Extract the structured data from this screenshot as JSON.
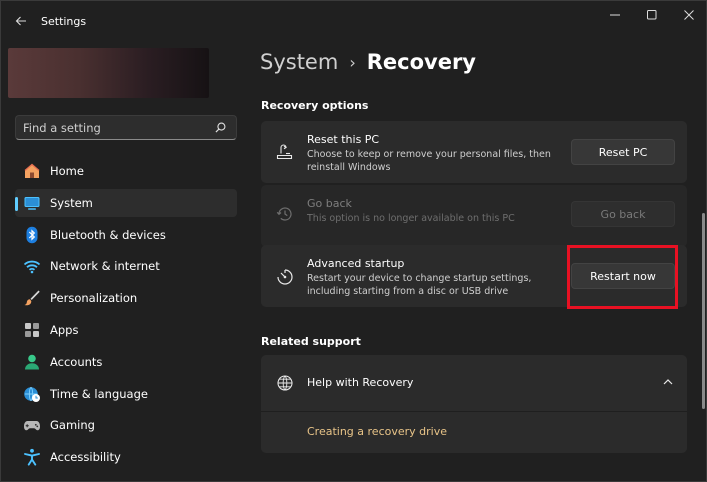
{
  "window": {
    "title": "Settings"
  },
  "search": {
    "placeholder": "Find a setting"
  },
  "sidebar": {
    "items": [
      {
        "label": "Home",
        "icon": "home-icon"
      },
      {
        "label": "System",
        "icon": "system-icon",
        "active": true
      },
      {
        "label": "Bluetooth & devices",
        "icon": "bluetooth-icon"
      },
      {
        "label": "Network & internet",
        "icon": "wifi-icon"
      },
      {
        "label": "Personalization",
        "icon": "brush-icon"
      },
      {
        "label": "Apps",
        "icon": "apps-icon"
      },
      {
        "label": "Accounts",
        "icon": "account-icon"
      },
      {
        "label": "Time & language",
        "icon": "globe-clock-icon"
      },
      {
        "label": "Gaming",
        "icon": "gamepad-icon"
      },
      {
        "label": "Accessibility",
        "icon": "accessibility-icon"
      }
    ]
  },
  "breadcrumb": {
    "parent": "System",
    "separator": "›",
    "current": "Recovery"
  },
  "recovery_options": {
    "title": "Recovery options",
    "cards": [
      {
        "title": "Reset this PC",
        "description": "Choose to keep or remove your personal files, then reinstall Windows",
        "button": "Reset PC",
        "icon": "reset-pc-icon"
      },
      {
        "title": "Go back",
        "description": "This option is no longer available on this PC",
        "button": "Go back",
        "icon": "history-icon",
        "disabled": true
      },
      {
        "title": "Advanced startup",
        "description": "Restart your device to change startup settings, including starting from a disc or USB drive",
        "button": "Restart now",
        "icon": "advanced-startup-icon",
        "highlighted": true
      }
    ]
  },
  "related_support": {
    "title": "Related support",
    "help": {
      "title": "Help with Recovery",
      "expanded": true,
      "link": "Creating a recovery drive",
      "icon": "globe-icon"
    }
  },
  "colors": {
    "accent": "#60cdff",
    "highlight": "#e81123",
    "link": "#e8c488",
    "background": "#202020",
    "card": "#2b2b2b"
  }
}
